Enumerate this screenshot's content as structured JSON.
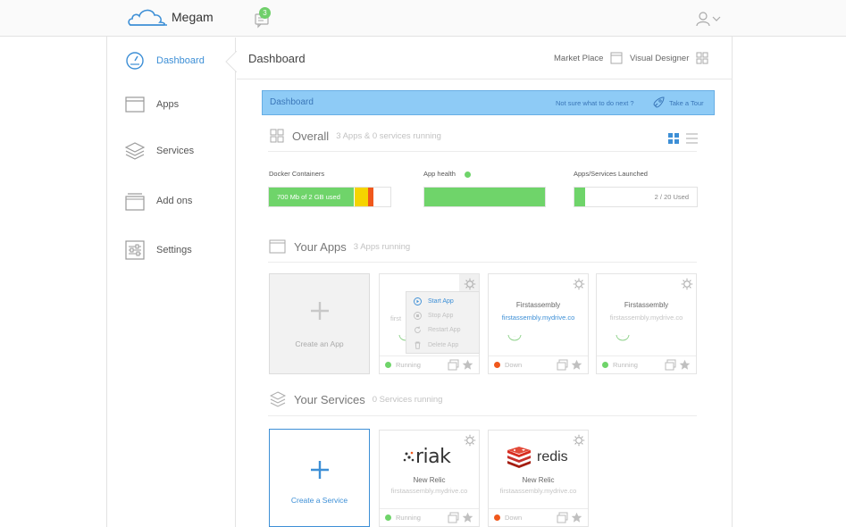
{
  "app": {
    "brand": "Megam",
    "notifications": "3"
  },
  "sidebar": {
    "items": [
      {
        "label": "Dashboard",
        "icon": "gauge-icon",
        "active": true
      },
      {
        "label": "Apps",
        "icon": "window-icon"
      },
      {
        "label": "Services",
        "icon": "layers-icon"
      },
      {
        "label": "Add ons",
        "icon": "stack-icon"
      },
      {
        "label": "Settings",
        "icon": "sliders-icon"
      }
    ]
  },
  "header": {
    "title": "Dashboard",
    "marketplace": "Market Place",
    "visual_designer": "Visual Designer"
  },
  "banner": {
    "title": "Dashboard",
    "question": "Not sure what to do next ?",
    "tour": "Take a Tour"
  },
  "overall": {
    "title": "Overall",
    "subtitle": "3 Apps & 0 services running",
    "docker": {
      "label": "Docker Containers",
      "value_text": "700 Mb of 2 GB used",
      "used_fraction": 0.34
    },
    "health": {
      "label": "App health",
      "status_color": "#6fd46a",
      "fill_fraction": 1.0
    },
    "launched": {
      "label": "Apps/Services Launched",
      "value_text": "2 / 20 Used",
      "used_fraction": 0.1
    }
  },
  "apps": {
    "title": "Your Apps",
    "subtitle": "3 Apps running",
    "create_label": "Create an App",
    "menu": [
      "Start App",
      "Stop App",
      "Restart App",
      "Delete App"
    ],
    "cards": [
      {
        "name": "",
        "url": "first",
        "status": "Running",
        "status_color": "#6fd46a"
      },
      {
        "name": "Firstassembly",
        "url": "firstassembly.mydrive.co",
        "status": "Down",
        "status_color": "#f0581c"
      },
      {
        "name": "Firstassembly",
        "url": "firstassembly.mydrive.co",
        "status": "Running",
        "status_color": "#6fd46a"
      }
    ]
  },
  "services": {
    "title": "Your Services",
    "subtitle": "0 Services running",
    "create_label": "Create a Service",
    "cards": [
      {
        "logo": "riak",
        "name": "New Relic",
        "url": "firstaassembly.mydrive.co",
        "status": "Running",
        "status_color": "#6fd46a"
      },
      {
        "logo": "redis",
        "name": "New Relic",
        "url": "firstaassembly.mydrive.co",
        "status": "Down",
        "status_color": "#f0581c"
      }
    ]
  },
  "colors": {
    "accent": "#3d8fd6",
    "banner": "#8ecbf6",
    "green": "#6fd46a",
    "yellow": "#f5d400",
    "orange": "#f0581c"
  }
}
